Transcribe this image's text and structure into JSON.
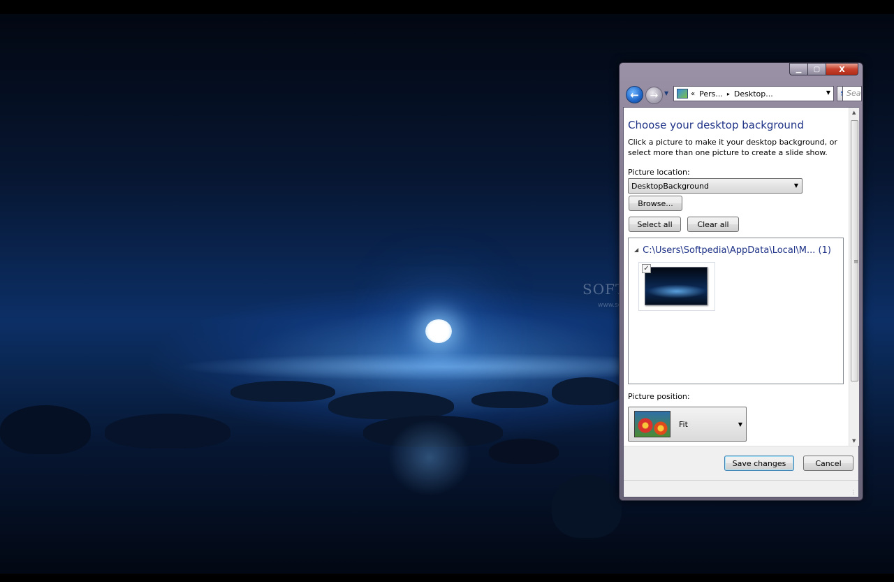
{
  "watermark": {
    "text": "SOFTPEDIA",
    "url": "www.softpedia.com"
  },
  "window": {
    "caption_buttons": {
      "minimize": "▁",
      "maximize": "▢",
      "close": "X"
    },
    "nav": {
      "back_icon": "back-arrow-icon",
      "forward_icon": "forward-arrow-icon",
      "address": {
        "chevron": "«",
        "segments": [
          "Pers...",
          "Desktop..."
        ],
        "separator": "▸"
      },
      "search_placeholder": "Search"
    },
    "content": {
      "title": "Choose your desktop background",
      "description": "Click a picture to make it your desktop background, or select more than one picture to create a slide show.",
      "picture_location_label": "Picture location:",
      "picture_location_value": "DesktopBackground",
      "browse_label": "Browse...",
      "select_all_label": "Select all",
      "clear_all_label": "Clear all",
      "group_header": "C:\\Users\\Softpedia\\AppData\\Local\\M... (1)",
      "thumbnail_checked": true,
      "picture_position_label": "Picture position:",
      "picture_position_value": "Fit"
    },
    "footer": {
      "save_label": "Save changes",
      "cancel_label": "Cancel"
    }
  },
  "colors": {
    "title_blue": "#1e3287",
    "accent_blue": "#1f66c8",
    "close_red": "#c7412c"
  }
}
